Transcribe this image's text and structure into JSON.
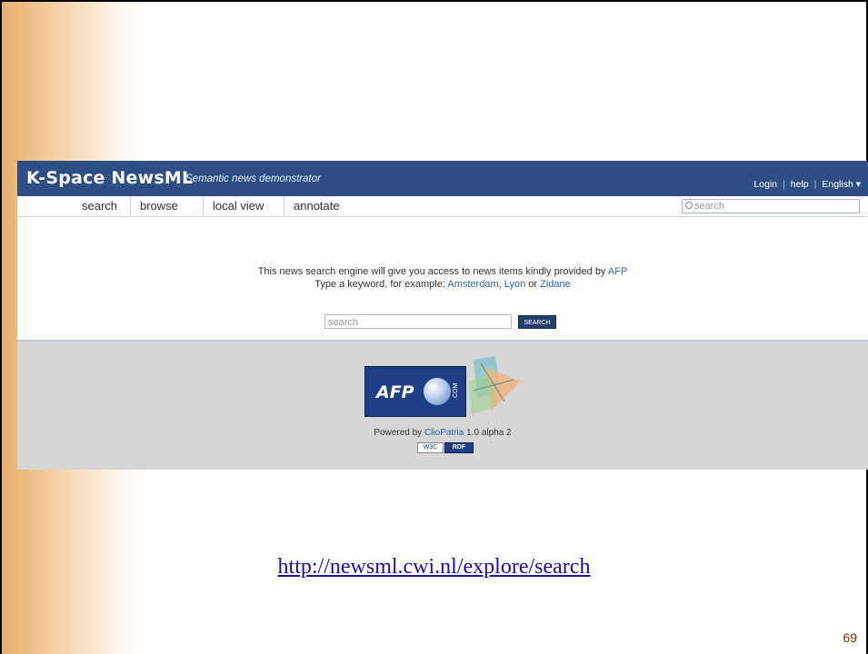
{
  "app": {
    "brand": "K-Space NewsML",
    "tagline": "Semantic news demonstrator",
    "top_links": {
      "login": "Login",
      "help": "help",
      "language": "English ▾"
    }
  },
  "nav": {
    "items": [
      {
        "label": "search"
      },
      {
        "label": "browse"
      },
      {
        "label": "local view"
      },
      {
        "label": "annotate"
      }
    ],
    "search_placeholder": "search"
  },
  "main": {
    "intro_text": "This news search engine will give you access to news items kindly provided by",
    "intro_link": "AFP",
    "example_text": "Type a keyword, for example:",
    "example_links": [
      "Amsterdam",
      "Lyon",
      "Zidane"
    ],
    "example_join_comma": ",",
    "example_join_or": "or",
    "search_placeholder": "search",
    "search_button": "SEARCH"
  },
  "footer": {
    "afp_logo_text": "AFP",
    "afp_logo_com": ".COM",
    "powered_prefix": "Powered by",
    "powered_link": "ClioPatria",
    "powered_version": "1.0 alpha 2",
    "badge_w3c": "W3C",
    "badge_rdf": "RDF"
  },
  "slide": {
    "url": "http://newsml.cwi.nl/explore/search",
    "page_number": "69"
  },
  "colors": {
    "header_blue": "#2d4f86",
    "link_blue": "#3366aa",
    "footer_gray": "#d6d6d6",
    "accent_orange": "#e7b06e"
  }
}
